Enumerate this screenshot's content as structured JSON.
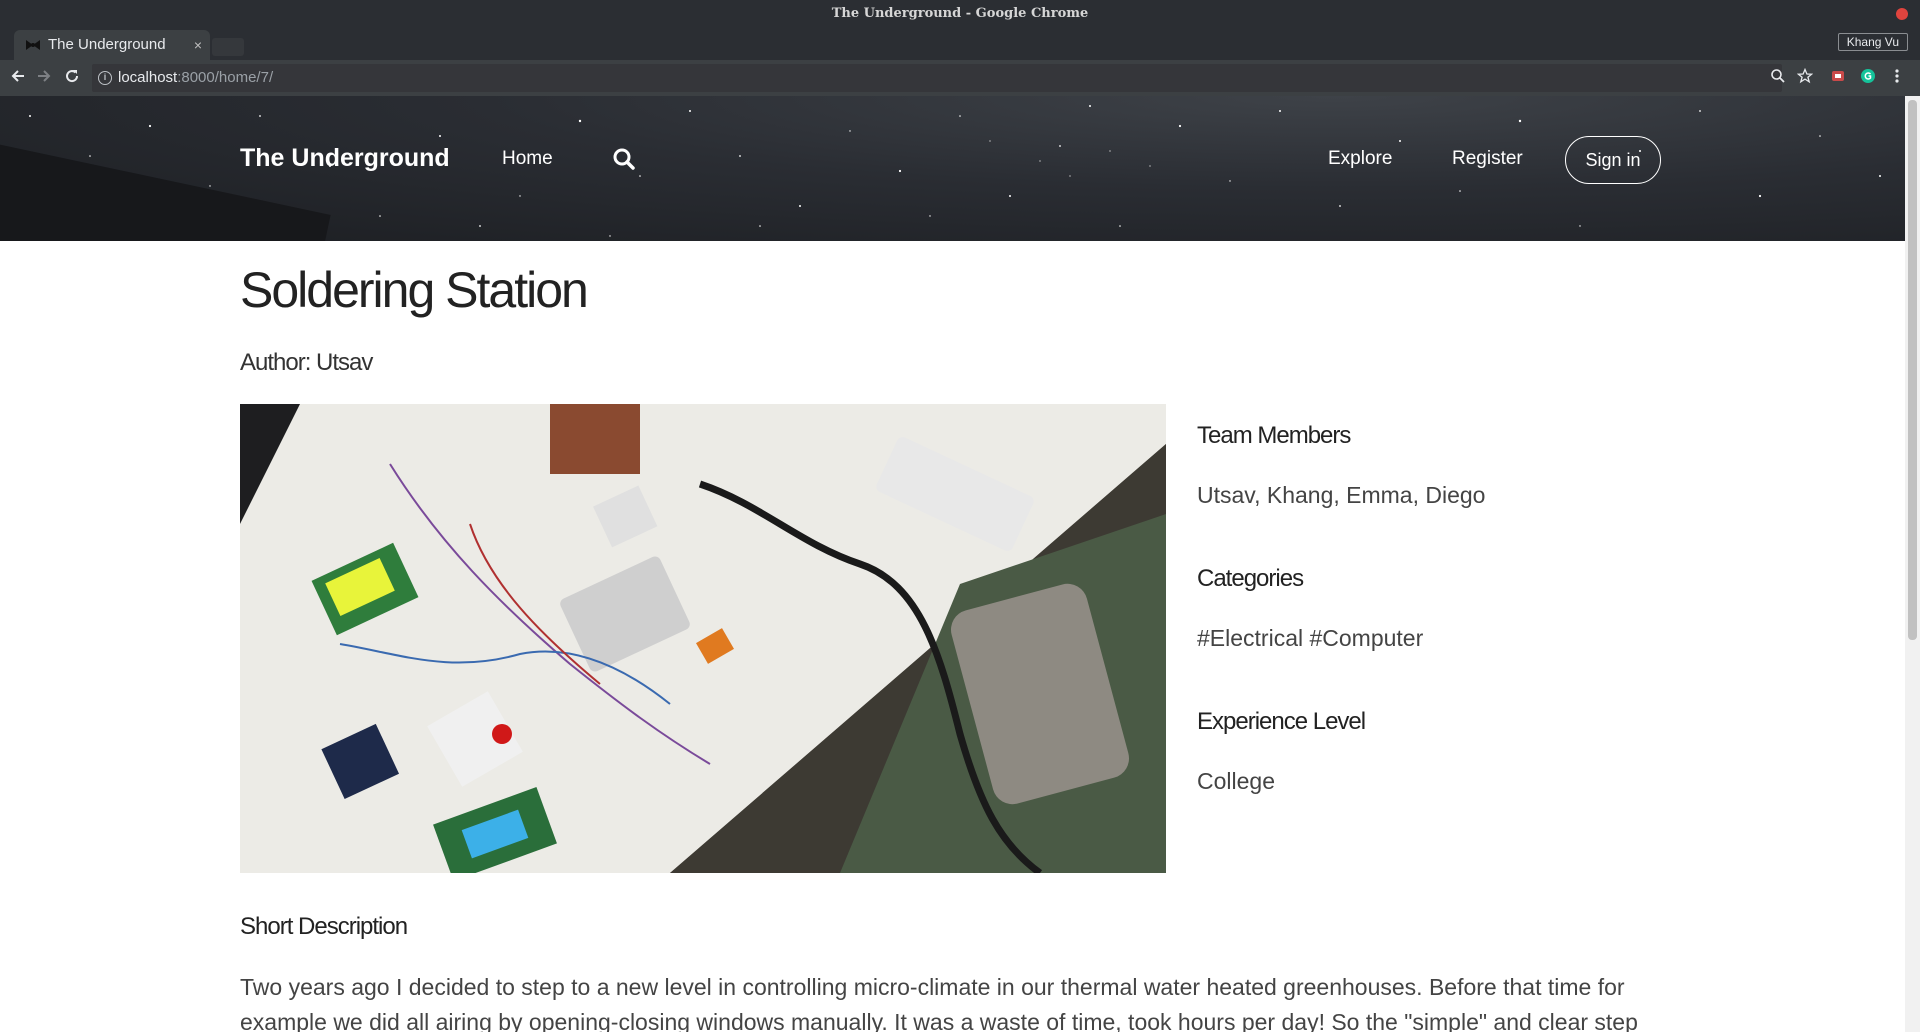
{
  "window": {
    "title": "The Underground - Google Chrome"
  },
  "tab": {
    "title": "The Underground",
    "close": "×"
  },
  "profile": {
    "name": "Khang Vu"
  },
  "address_bar": {
    "host": "localhost",
    "path": ":8000/home/7/"
  },
  "navbar": {
    "brand": "The Underground",
    "home": "Home",
    "explore": "Explore",
    "register": "Register",
    "sign_in": "Sign in"
  },
  "project": {
    "title": "Soldering Station",
    "author": "Author: Utsav",
    "team_heading": "Team Members",
    "team": "Utsav, Khang, Emma, Diego",
    "categories_heading": "Categories",
    "categories": "#Electrical #Computer",
    "experience_heading": "Experience Level",
    "experience": "College",
    "short_description_heading": "Short Description",
    "short_description": "Two years ago I decided to step to a new level in controlling micro-climate in our thermal water heated greenhouses. Before that time for example we did all airing by opening-closing windows manually. It was a waste of time, took hours per day! So the \"simple\" and clear step was to build automatic"
  },
  "colors": {
    "hero_bg": "#2a2d33",
    "chrome_frame": "#2b2e33",
    "text": "#333333"
  },
  "icons": [
    "back-icon",
    "forward-icon",
    "reload-icon",
    "info-icon",
    "search-icon",
    "zoom-icon",
    "star-icon",
    "extension-icon",
    "grammarly-icon",
    "menu-icon",
    "close-window-icon"
  ]
}
